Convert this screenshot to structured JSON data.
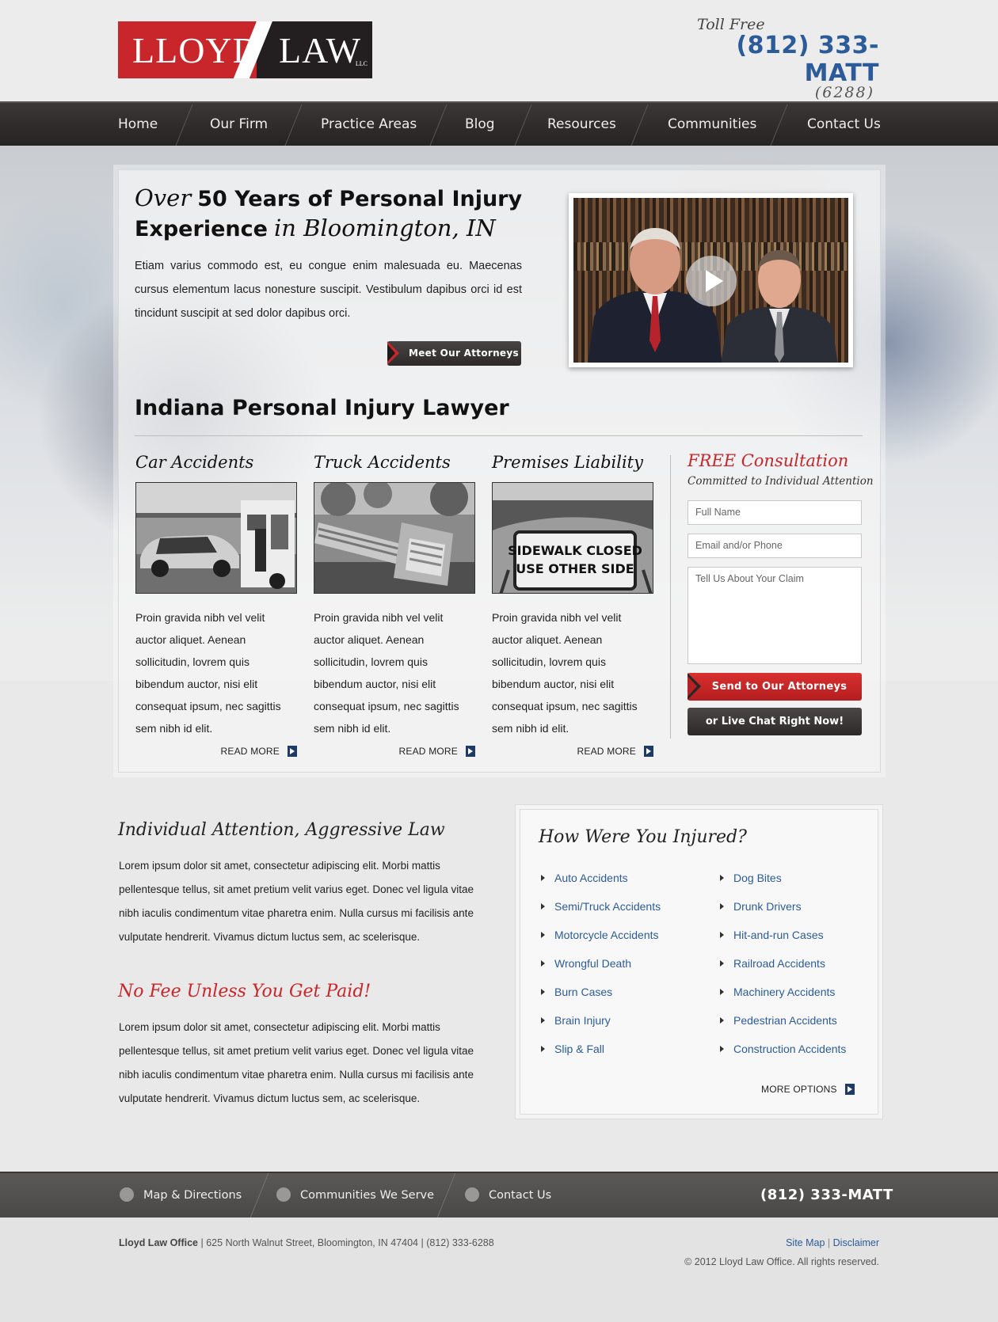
{
  "header": {
    "logo": {
      "word1": "LLOYD",
      "word2": "LAW",
      "suffix": "LLC"
    },
    "toll_free_label": "Toll Free",
    "phone": "(812) 333-MATT",
    "phone_digits": "(6288)"
  },
  "nav": {
    "items": [
      {
        "label": "Home"
      },
      {
        "label": "Our Firm"
      },
      {
        "label": "Practice Areas"
      },
      {
        "label": "Blog"
      },
      {
        "label": "Resources"
      },
      {
        "label": "Communities"
      },
      {
        "label": "Contact Us"
      }
    ]
  },
  "hero": {
    "title_over": "Over",
    "title_bold1": "50 Years of Personal Injury",
    "title_bold2": "Experience",
    "title_in": "in Bloomington, IN",
    "text": "Etiam varius commodo est, eu congue enim malesuada eu. Maecenas cursus elementum lacus nonesture suscipit. Vestibulum  dapibus orci id est tincidunt suscipit at sed dolor dapibus orci.",
    "button": "Meet Our Attorneys",
    "video_icon": "play-icon"
  },
  "section": {
    "title": "Indiana Personal Injury Lawyer"
  },
  "areas": [
    {
      "title": "Car Accidents",
      "text": "Proin gravida nibh vel velit auctor aliquet. Aenean sollicitudin, lovrem quis bibendum auctor, nisi elit consequat ipsum, nec sagittis sem nibh id elit.",
      "link": "READ MORE"
    },
    {
      "title": "Truck Accidents",
      "text": "Proin gravida nibh vel velit auctor aliquet. Aenean sollicitudin, lovrem quis bibendum auctor, nisi elit consequat ipsum, nec sagittis sem nibh id elit.",
      "link": "READ MORE"
    },
    {
      "title": "Premises Liability",
      "text": "Proin gravida nibh vel velit auctor aliquet. Aenean sollicitudin, lovrem quis bibendum auctor, nisi elit consequat ipsum, nec sagittis sem nibh id elit.",
      "link": "READ MORE",
      "sign_line1": "SIDEWALK CLOSED",
      "sign_line2": "USE OTHER SIDE"
    }
  ],
  "consult": {
    "title": "FREE Consultation",
    "subtitle": "Committed to Individual Attention",
    "name_placeholder": "Full Name",
    "contact_placeholder": "Email and/or Phone",
    "claim_placeholder": "Tell Us About Your Claim",
    "send_button": "Send to Our Attorneys",
    "chat_button": "or Live Chat Right Now!"
  },
  "lower": {
    "attention_title": "Individual Attention, Aggressive Law",
    "attention_text": "Lorem ipsum dolor sit amet, consectetur adipiscing elit. Morbi mattis pellentesque tellus, sit amet pretium velit varius eget. Donec vel ligula vitae nibh iaculis condimentum vitae pharetra enim. Nulla cursus mi facilisis ante vulputate hendrerit. Vivamus dictum luctus sem, ac scelerisque.",
    "nofee_title": "No Fee Unless You Get Paid!",
    "nofee_text": "Lorem ipsum dolor sit amet, consectetur adipiscing elit. Morbi mattis pellentesque tellus, sit amet pretium velit varius eget. Donec vel ligula vitae nibh iaculis condimentum vitae pharetra enim. Nulla cursus mi facilisis ante vulputate hendrerit. Vivamus dictum luctus sem, ac scelerisque."
  },
  "injured": {
    "title": "How Were You Injured?",
    "left": [
      "Auto Accidents",
      "Semi/Truck Accidents",
      "Motorcycle Accidents",
      "Wrongful Death",
      "Burn Cases",
      "Brain Injury",
      "Slip & Fall"
    ],
    "right": [
      "Dog Bites",
      "Drunk Drivers",
      "Hit-and-run Cases",
      "Railroad Accidents",
      "Machinery Accidents",
      "Pedestrian Accidents",
      "Construction Accidents"
    ],
    "more": "MORE OPTIONS"
  },
  "footer_bar": {
    "items": [
      {
        "label": "Map & Directions",
        "icon": "map-pin-icon"
      },
      {
        "label": "Communities We Serve",
        "icon": "person-icon"
      },
      {
        "label": "Contact Us",
        "icon": "mail-icon"
      }
    ],
    "phone": "(812) 333-MATT"
  },
  "footer": {
    "office": "Lloyd Law Office",
    "address": "625 North Walnut Street, Bloomington, IN 47404",
    "phone": "(812) 333-6288",
    "sitemap": "Site Map",
    "disclaimer": "Disclaimer",
    "copyright": "© 2012 Lloyd Law Office.  All rights reserved."
  },
  "colors": {
    "brand_red": "#c8262b",
    "link_blue": "#2c5b9a",
    "nav_dark": "#2e2b2a"
  }
}
